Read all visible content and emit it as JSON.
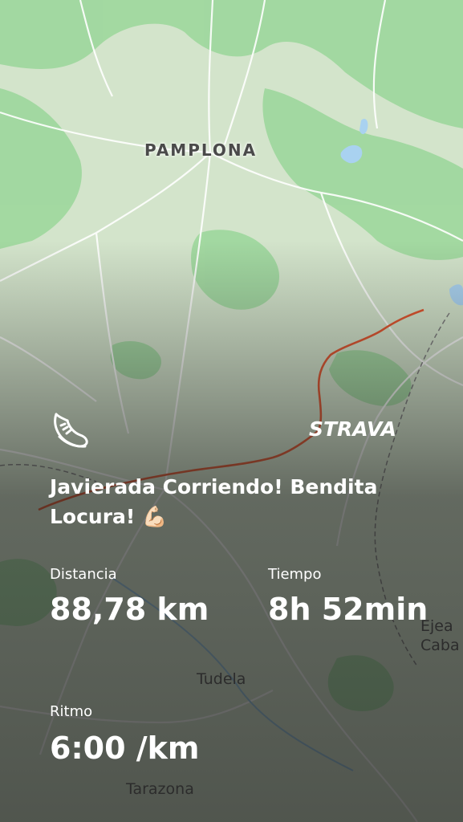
{
  "map": {
    "labels": {
      "pamplona": "PAMPLONA",
      "tudela": "Tudela",
      "tarazona": "Tarazona",
      "ejea": "Ejea\nCaba"
    },
    "route_color": "#e0522a",
    "land_color": "#cfe3c4",
    "forest_color": "#8fd08c"
  },
  "activity": {
    "icon": "running-shoe-icon",
    "brand": "STRAVA",
    "title": "Javierada Corriendo! Bendita Locura! 💪🏻",
    "stats": {
      "distance_label": "Distancia",
      "distance_value": "88,78 km",
      "time_label": "Tiempo",
      "time_value": "8h 52min",
      "pace_label": "Ritmo",
      "pace_value": "6:00 /km"
    }
  }
}
